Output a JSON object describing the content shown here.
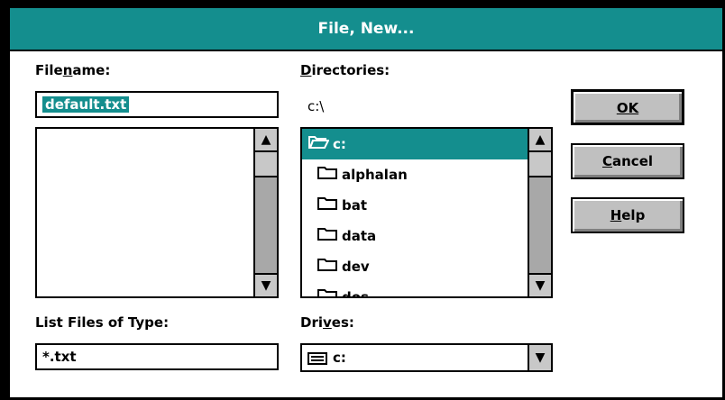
{
  "window": {
    "title": "File, New..."
  },
  "labels": {
    "filename": "Filename:",
    "directories": "Directories:",
    "list_files_of_type": "List Files of Type:",
    "drives": "Drives:"
  },
  "filename_input": {
    "value": "default.txt"
  },
  "current_dir": "c:\\",
  "directories": [
    {
      "label": "c:",
      "icon": "open-folder-icon",
      "selected": true
    },
    {
      "label": "alphalan",
      "icon": "folder-icon"
    },
    {
      "label": "bat",
      "icon": "folder-icon"
    },
    {
      "label": "data",
      "icon": "folder-icon"
    },
    {
      "label": "dev",
      "icon": "folder-icon"
    },
    {
      "label": "dos",
      "icon": "folder-icon"
    }
  ],
  "file_type": {
    "value": "*.txt"
  },
  "drive": {
    "value": "c:",
    "icon": "drive-icon"
  },
  "buttons": {
    "ok": "OK",
    "cancel": "Cancel",
    "help": "Help"
  },
  "colors": {
    "accent": "#148e8e",
    "button_face": "#c0c0c0",
    "scroll_track": "#a8a8a8"
  }
}
